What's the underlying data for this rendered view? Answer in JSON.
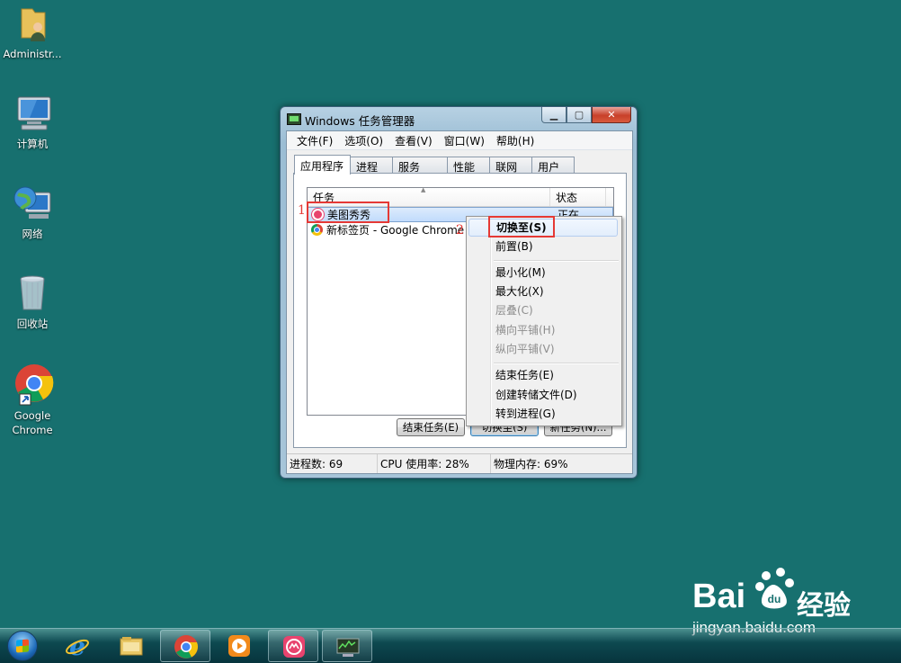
{
  "desktop": {
    "icons": [
      {
        "label": "Administr...",
        "icon": "user-folder-icon"
      },
      {
        "label": "计算机",
        "icon": "computer-icon"
      },
      {
        "label": "网络",
        "icon": "network-icon"
      },
      {
        "label": "回收站",
        "icon": "recycle-bin-icon"
      },
      {
        "label": "Google\nChrome",
        "label_line1": "Google",
        "label_line2": "Chrome",
        "icon": "chrome-icon"
      }
    ]
  },
  "window": {
    "title": "Windows 任务管理器",
    "menu": [
      "文件(F)",
      "选项(O)",
      "查看(V)",
      "窗口(W)",
      "帮助(H)"
    ],
    "tabs": [
      "应用程序",
      "进程",
      "服务",
      "性能",
      "联网",
      "用户"
    ],
    "active_tab": "应用程序",
    "columns": {
      "task": "任务",
      "status": "状态"
    },
    "tasks": [
      {
        "name": "美图秀秀",
        "status": "正在",
        "icon": "meitu-icon"
      },
      {
        "name": "新标签页 - Google Chrome",
        "status": "",
        "icon": "chrome-icon"
      }
    ],
    "buttons": {
      "end_task": "结束任务(E)",
      "switch_to": "切换至(S)",
      "new_task": "新任务(N)..."
    },
    "statusbar": {
      "processes": "进程数: 69",
      "cpu": "CPU 使用率: 28%",
      "memory": "物理内存: 69%"
    }
  },
  "context_menu": {
    "items": [
      {
        "label": "切换至(S)",
        "bold": true,
        "enabled": true
      },
      {
        "label": "前置(B)",
        "enabled": true
      },
      {
        "label": "最小化(M)",
        "enabled": true
      },
      {
        "label": "最大化(X)",
        "enabled": true
      },
      {
        "label": "层叠(C)",
        "enabled": false
      },
      {
        "label": "横向平铺(H)",
        "enabled": false
      },
      {
        "label": "纵向平铺(V)",
        "enabled": false
      },
      {
        "label": "结束任务(E)",
        "enabled": true
      },
      {
        "label": "创建转储文件(D)",
        "enabled": true
      },
      {
        "label": "转到进程(G)",
        "enabled": true
      }
    ]
  },
  "annotations": {
    "step1": "1",
    "step2": "2"
  },
  "taskbar": {
    "items": [
      "start-orb-icon",
      "internet-explorer-icon",
      "file-explorer-icon",
      "chrome-icon",
      "media-player-icon",
      "meitu-icon",
      "task-manager-icon"
    ]
  },
  "watermark": {
    "brand": "Bai",
    "brand_cn": "经验",
    "url": "jingyan.baidu.com"
  },
  "colors": {
    "desktop": "#17706f",
    "annotation_red": "#e53935",
    "selection": "#c1dbfc"
  }
}
